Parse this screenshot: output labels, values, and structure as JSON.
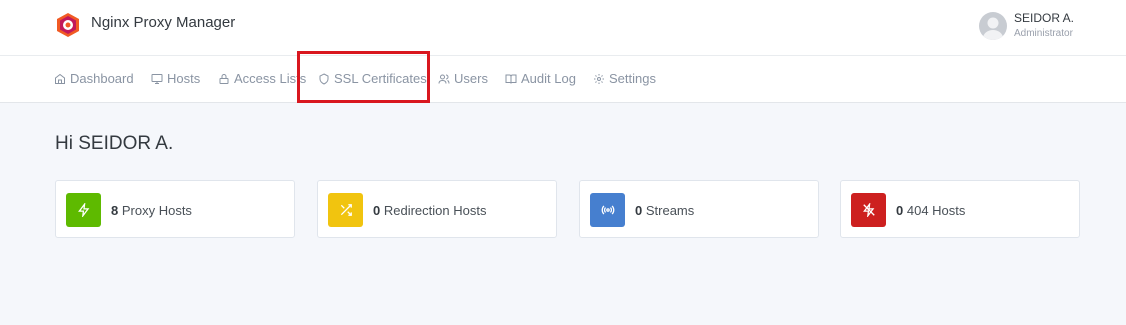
{
  "header": {
    "app_title": "Nginx Proxy Manager",
    "logo_icon": "nginx-proxy-manager-logo",
    "user": {
      "name": "SEIDOR A.",
      "role": "Administrator",
      "avatar_icon": "user-avatar-icon"
    }
  },
  "nav": {
    "items": [
      {
        "label": "Dashboard",
        "icon": "home-icon"
      },
      {
        "label": "Hosts",
        "icon": "monitor-icon"
      },
      {
        "label": "Access Lists",
        "icon": "lock-icon"
      },
      {
        "label": "SSL Certificates",
        "icon": "shield-icon"
      },
      {
        "label": "Users",
        "icon": "users-icon"
      },
      {
        "label": "Audit Log",
        "icon": "book-icon"
      },
      {
        "label": "Settings",
        "icon": "gear-icon"
      }
    ],
    "highlighted": "SSL Certificates"
  },
  "main": {
    "greeting": "Hi SEIDOR A.",
    "cards": [
      {
        "count": "8",
        "label": "Proxy Hosts",
        "icon": "zap-icon",
        "color": "#5eba00"
      },
      {
        "count": "0",
        "label": "Redirection Hosts",
        "icon": "shuffle-icon",
        "color": "#f1c40f"
      },
      {
        "count": "0",
        "label": "Streams",
        "icon": "radio-icon",
        "color": "#467fcf"
      },
      {
        "count": "0",
        "label": "404 Hosts",
        "icon": "zap-off-icon",
        "color": "#cd201f"
      }
    ]
  },
  "colors": {
    "highlight_border": "#d9171f",
    "background": "#f5f7fb"
  }
}
